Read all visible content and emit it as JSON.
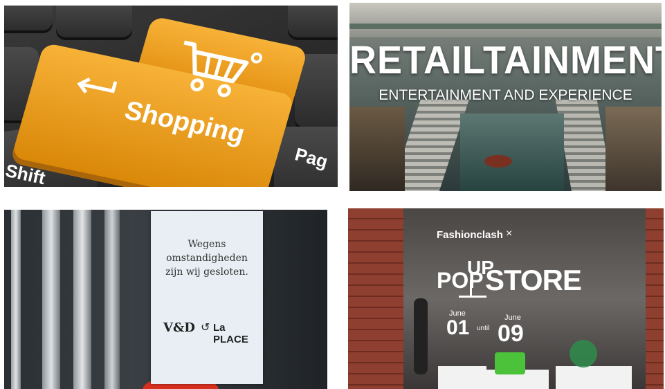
{
  "tiles": {
    "shopping": {
      "key_label": "Shopping",
      "shift_label": "Shift",
      "pag_label": "Pag",
      "icons": [
        "cart-icon",
        "enter-arrow-icon"
      ]
    },
    "retailtainment": {
      "title": "RETAILTAINMENT",
      "subtitle": "ENTERTAINMENT AND EXPERIENCE"
    },
    "sign": {
      "line1": "Wegens",
      "line2": "omstandigheden",
      "line3": "zijn wij gesloten.",
      "brand1": "V&D",
      "brand2": "La PLACE"
    },
    "popup": {
      "brand": "Fashionclash",
      "cross": "×",
      "title_pop": "POP",
      "title_up": "UP",
      "title_store": "STORE",
      "date_from_month": "June",
      "date_from_day": "01",
      "until": "until",
      "date_to_month": "June",
      "date_to_day": "09"
    }
  },
  "colors": {
    "key_orange": "#f0a21e",
    "brick": "#8a3d2e",
    "green_bag": "#4cc23a"
  }
}
